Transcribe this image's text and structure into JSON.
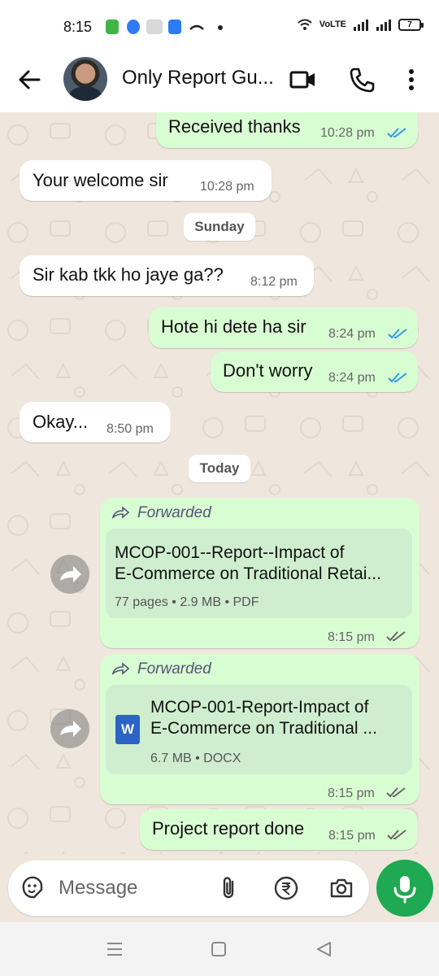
{
  "status_bar": {
    "time": "8:15",
    "network": "VoLTE",
    "battery": "7"
  },
  "header": {
    "title": "Only Report Gu..."
  },
  "messages": [
    {
      "direction": "out",
      "text": "Received thanks",
      "time": "10:28 pm",
      "read": true
    },
    {
      "direction": "in",
      "text": "Your welcome sir",
      "time": "10:28 pm"
    },
    {
      "direction": "in",
      "text": "Sir kab tkk ho jaye ga??",
      "time": "8:12 pm"
    },
    {
      "direction": "out",
      "text": "Hote hi dete ha sir",
      "time": "8:24 pm",
      "read": true
    },
    {
      "direction": "out",
      "text": "Don't worry",
      "time": "8:24 pm",
      "read": true
    },
    {
      "direction": "in",
      "text": "Okay...",
      "time": "8:50 pm"
    },
    {
      "direction": "out",
      "forwarded_label": "Forwarded",
      "document": {
        "title_line1": "MCOP-001--Report--Impact of",
        "title_line2": "E-Commerce on Traditional Retai...",
        "meta": "77 pages • 2.9 MB • PDF"
      },
      "time": "8:15 pm",
      "read": false
    },
    {
      "direction": "out",
      "forwarded_label": "Forwarded",
      "document": {
        "icon_letter": "W",
        "title_line1": "MCOP-001-Report-Impact of",
        "title_line2": "E-Commerce on Traditional ...",
        "meta": "6.7 MB • DOCX"
      },
      "time": "8:15 pm",
      "read": false
    },
    {
      "direction": "out",
      "text": "Project report done",
      "time": "8:15 pm",
      "read": false
    }
  ],
  "day_separators": [
    "Sunday",
    "Today"
  ],
  "composer": {
    "placeholder": "Message"
  },
  "colors": {
    "outgoing_bubble": "#d9fdd3",
    "incoming_bubble": "#ffffff",
    "read_tick": "#2f9be0",
    "sent_tick": "#666666",
    "mic_button": "#1ea952",
    "word_icon": "#2b63c6"
  },
  "icons": [
    "back-arrow-icon",
    "video-call-icon",
    "phone-icon",
    "more-vert-icon",
    "sticker-icon",
    "attach-icon",
    "rupee-icon",
    "camera-icon",
    "mic-icon",
    "forward-icon",
    "share-icon",
    "word-doc-icon"
  ]
}
